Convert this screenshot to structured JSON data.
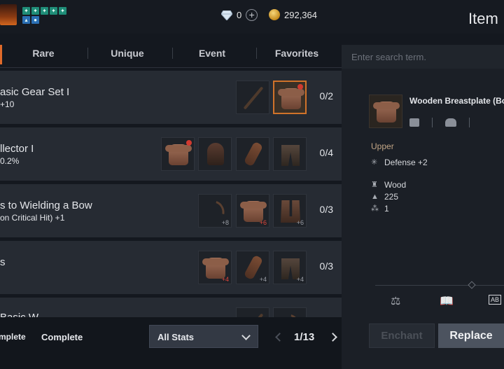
{
  "header": {
    "currencies": [
      {
        "icon": "diamond-icon",
        "value": "0"
      },
      {
        "icon": "gold-coin-icon",
        "value": "292,364"
      }
    ],
    "title": "Item"
  },
  "tabs": [
    {
      "label": "Rare"
    },
    {
      "label": "Unique"
    },
    {
      "label": "Event"
    },
    {
      "label": "Favorites"
    }
  ],
  "sets": [
    {
      "name": "asic Gear Set I",
      "bonus": "+10",
      "count": "0/2",
      "slots": [
        {
          "icon": "bow-icon",
          "enhancement": ""
        },
        {
          "icon": "chest-armor-icon",
          "enhancement": "",
          "selected": true
        }
      ]
    },
    {
      "name": "llector I",
      "bonus": "0.2%",
      "count": "0/4",
      "slots": [
        {
          "icon": "chest-armor-icon",
          "enhancement": ""
        },
        {
          "icon": "helmet-icon",
          "enhancement": ""
        },
        {
          "icon": "gloves-icon",
          "enhancement": ""
        },
        {
          "icon": "pants-icon",
          "enhancement": ""
        }
      ]
    },
    {
      "name": "s to Wielding a Bow",
      "bonus": "on Critical Hit) +1",
      "count": "0/3",
      "slots": [
        {
          "icon": "bow-icon",
          "enhancement": "+8"
        },
        {
          "icon": "chest-armor-icon",
          "enhancement": "+6"
        },
        {
          "icon": "boots-icon",
          "enhancement": "+6"
        }
      ]
    },
    {
      "name": "s",
      "bonus": "",
      "count": "0/3",
      "slots": [
        {
          "icon": "chest-armor-icon",
          "enhancement": "+4"
        },
        {
          "icon": "gloves-icon",
          "enhancement": "+4"
        },
        {
          "icon": "pants-icon",
          "enhancement": "+4"
        }
      ]
    },
    {
      "name": "Basic W",
      "bonus": "",
      "count": "",
      "slots": []
    }
  ],
  "bottom": {
    "filter1": "mplete",
    "filter2": "Complete",
    "stats_select": "All Stats",
    "page": "1/13"
  },
  "search": {
    "placeholder": "Enter search term."
  },
  "detail": {
    "item_name": "Wooden Breastplate (Bo",
    "section": "Upper",
    "stats": [
      {
        "icon": "sparkle-icon",
        "text": "Defense +2"
      },
      {
        "icon": "material-icon",
        "text": "Wood"
      },
      {
        "icon": "weight-icon",
        "text": "225"
      },
      {
        "icon": "stack-icon",
        "text": "1"
      }
    ],
    "enchant_label": "Enchant",
    "replace_label": "Replace"
  }
}
